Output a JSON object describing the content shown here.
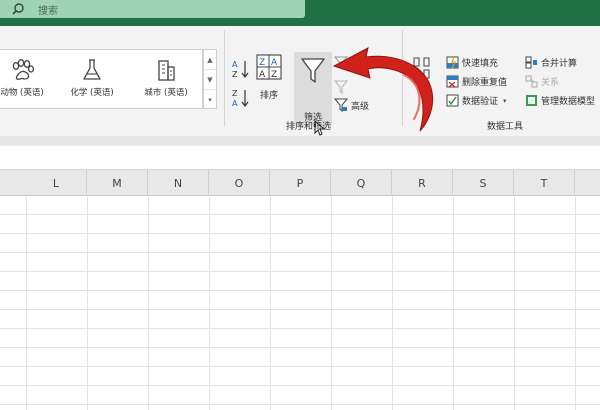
{
  "search": {
    "label": "搜索"
  },
  "gallery": {
    "items": [
      {
        "label": "动物 (英语)",
        "icon": "paw-icon"
      },
      {
        "label": "化学 (英语)",
        "icon": "flask-icon"
      },
      {
        "label": "城市 (英语)",
        "icon": "city-icon"
      }
    ]
  },
  "sort_filter": {
    "sort_label": "排序",
    "filter_label": "筛选",
    "advanced_label": "高级",
    "group_label": "排序和筛选"
  },
  "data_tools": {
    "flash_fill": "快速填充",
    "remove_duplicates": "删除重复值",
    "data_validation": "数据验证",
    "consolidate": "合并计算",
    "relationships": "关系",
    "manage_model": "管理数据模型",
    "group_label": "数据工具"
  },
  "columns": [
    "L",
    "M",
    "N",
    "O",
    "P",
    "Q",
    "R",
    "S",
    "T"
  ],
  "colors": {
    "titlebar": "#1f7145",
    "search_box": "#9fd3b7",
    "arrow": "#d0221a"
  }
}
